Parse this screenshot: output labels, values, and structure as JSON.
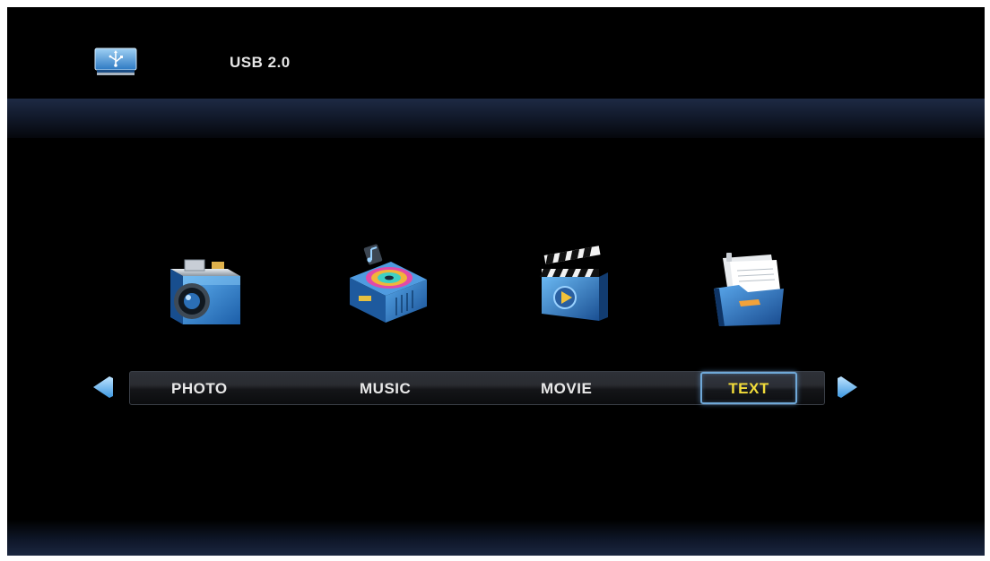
{
  "header": {
    "device_label": "USB 2.0",
    "device_icon": "usb-drive-icon"
  },
  "menu": {
    "items": [
      {
        "label": "PHOTO",
        "icon": "camera-icon",
        "selected": false
      },
      {
        "label": "MUSIC",
        "icon": "music-player-icon",
        "selected": false
      },
      {
        "label": "MOVIE",
        "icon": "clapperboard-icon",
        "selected": false
      },
      {
        "label": "TEXT",
        "icon": "document-folder-icon",
        "selected": true
      }
    ],
    "prev_arrow": "arrow-left-icon",
    "next_arrow": "arrow-right-icon"
  },
  "colors": {
    "selected_text": "#f2dc3a",
    "selected_border": "#6fa8d8",
    "menu_text": "#e8e8e8",
    "background": "#000000",
    "accent_blue": "#2f7fd0"
  }
}
